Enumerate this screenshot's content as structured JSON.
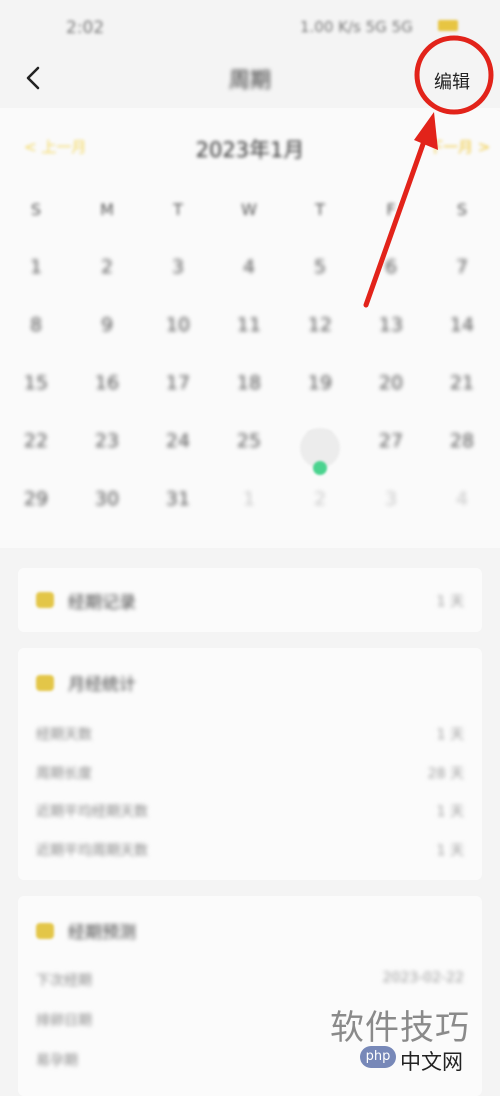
{
  "status_bar": {
    "time": "2:02",
    "right": "1.00 K/s 5G 5G"
  },
  "header": {
    "title": "周期",
    "edit_label": "编辑"
  },
  "calendar": {
    "prev_label": "< 上一月",
    "month_title": "2023年1月",
    "next_label": "下一月 >",
    "weekdays": [
      "S",
      "M",
      "T",
      "W",
      "T",
      "F",
      "S"
    ],
    "weeks": [
      [
        "1",
        "2",
        "3",
        "4",
        "5",
        "6",
        "7"
      ],
      [
        "8",
        "9",
        "10",
        "11",
        "12",
        "13",
        "14"
      ],
      [
        "15",
        "16",
        "17",
        "18",
        "19",
        "20",
        "21"
      ],
      [
        "22",
        "23",
        "24",
        "25",
        "26",
        "27",
        "28"
      ],
      [
        "29",
        "30",
        "31",
        "1",
        "2",
        "3",
        "4"
      ]
    ],
    "today": "26"
  },
  "record_card": {
    "title": "经期记录",
    "value": "1 天"
  },
  "stats_card": {
    "title": "月经统计",
    "rows": [
      {
        "label": "经期天数",
        "value": "1 天"
      },
      {
        "label": "周期长度",
        "value": "28 天"
      },
      {
        "label": "近期平均经期天数",
        "value": "1 天"
      },
      {
        "label": "近期平均周期天数",
        "value": "1 天"
      }
    ]
  },
  "prediction_card": {
    "title": "经期预测",
    "rows": [
      {
        "label": "下次经期",
        "value": "2023-02-22"
      },
      {
        "label": "排卵日期",
        "value": ""
      },
      {
        "label": "易孕期",
        "value": ""
      }
    ]
  },
  "watermark": {
    "text": "软件技巧",
    "badge": "php",
    "site": "中文网"
  },
  "colors": {
    "accent_yellow": "#f0c93a",
    "today_dot": "#4bd38f",
    "annotation_red": "#e2231a"
  }
}
